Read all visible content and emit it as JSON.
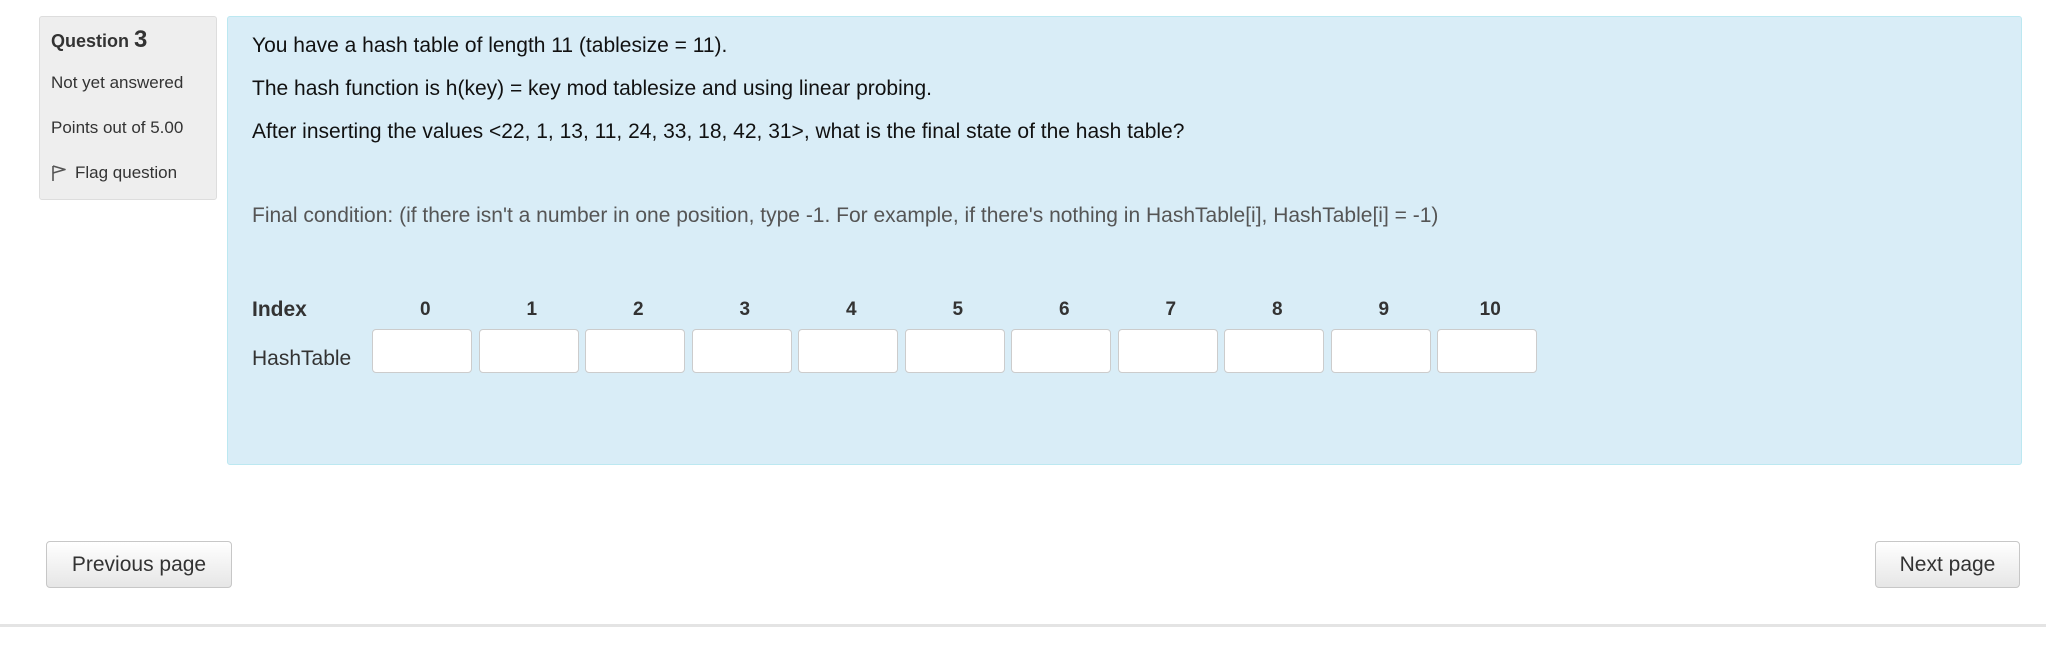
{
  "question_info": {
    "question_prefix": "Question",
    "question_number": "3",
    "status": "Not yet answered",
    "points": "Points out of 5.00",
    "flag_label": "Flag question"
  },
  "question": {
    "line1": "You have a hash table of length 11 (tablesize = 11).",
    "line2": "The hash function is h(key) = key mod tablesize and using linear probing.",
    "line3": "After inserting the values <22, 1, 13, 11, 24, 33, 18, 42, 31>, what is the final state of the hash table?",
    "instruction": "Final condition: (if there isn't a number in one position, type -1. For example, if there's nothing in HashTable[i], HashTable[i] = -1)"
  },
  "table": {
    "index_label": "Index",
    "row_label": "HashTable",
    "indices": [
      "0",
      "1",
      "2",
      "3",
      "4",
      "5",
      "6",
      "7",
      "8",
      "9",
      "10"
    ],
    "values": [
      "",
      "",
      "",
      "",
      "",
      "",
      "",
      "",
      "",
      "",
      ""
    ]
  },
  "navigation": {
    "previous": "Previous page",
    "next": "Next page"
  }
}
